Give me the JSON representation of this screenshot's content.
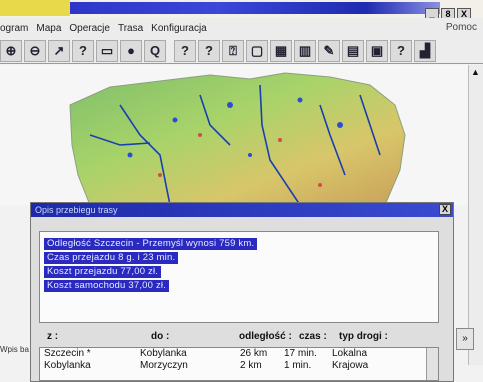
{
  "menu": [
    "ogram",
    "Mapa",
    "Operacje",
    "Trasa",
    "Konfiguracja"
  ],
  "help": "Pomoc",
  "window_buttons": [
    "_",
    "8",
    "X"
  ],
  "toolbar_icons": [
    "zoom-in-icon",
    "zoom-out-icon",
    "arrow-icon",
    "help-icon",
    "box-icon",
    "info-icon",
    "zoom-area-icon",
    "help-icon",
    "help-icon",
    "help-zoom-icon",
    "copy-icon",
    "map-icon",
    "chart-icon",
    "pen-icon",
    "document-icon",
    "image-icon",
    "help-icon",
    "city-icon"
  ],
  "dialog": {
    "title": "Opis przebiegu trasy",
    "close": "X",
    "summary": [
      "Odległość Szczecin - Przemyśl wynosi 759 km.",
      "Czas przejazdu 8 g. i 23 min.",
      "Koszt przejazdu 77,00 zł.",
      "Koszt samochodu 37,00 zł."
    ],
    "headers": {
      "from": "z :",
      "to": "do :",
      "distance": "odległość :",
      "time": "czas :",
      "road_type": "typ drogi :"
    },
    "rows": [
      {
        "from": "Szczecin *",
        "to": "Kobylanka",
        "distance": "26 km",
        "time": "17 min.",
        "road": "Lokalna"
      },
      {
        "from": "Kobylanka",
        "to": "Morzyczyn",
        "distance": "2 km",
        "time": "1 min.",
        "road": "Krajowa"
      }
    ]
  },
  "left_label": "Wpis ba"
}
